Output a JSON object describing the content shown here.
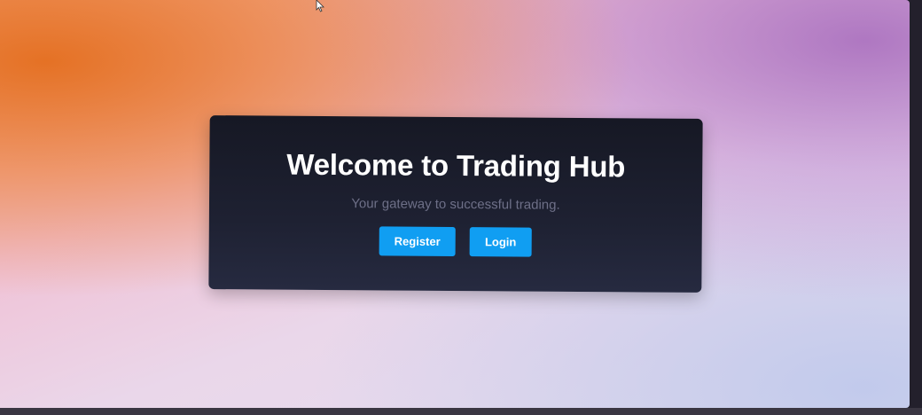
{
  "hero": {
    "title": "Welcome to Trading Hub",
    "subtitle": "Your gateway to successful trading.",
    "register_label": "Register",
    "login_label": "Login"
  },
  "colors": {
    "card_background": "#1c1f2e",
    "button_accent": "#109ef2",
    "title_text": "#ffffff",
    "subtitle_text": "#6e7088"
  },
  "icons": {
    "cursor": "mouse-pointer-icon"
  }
}
